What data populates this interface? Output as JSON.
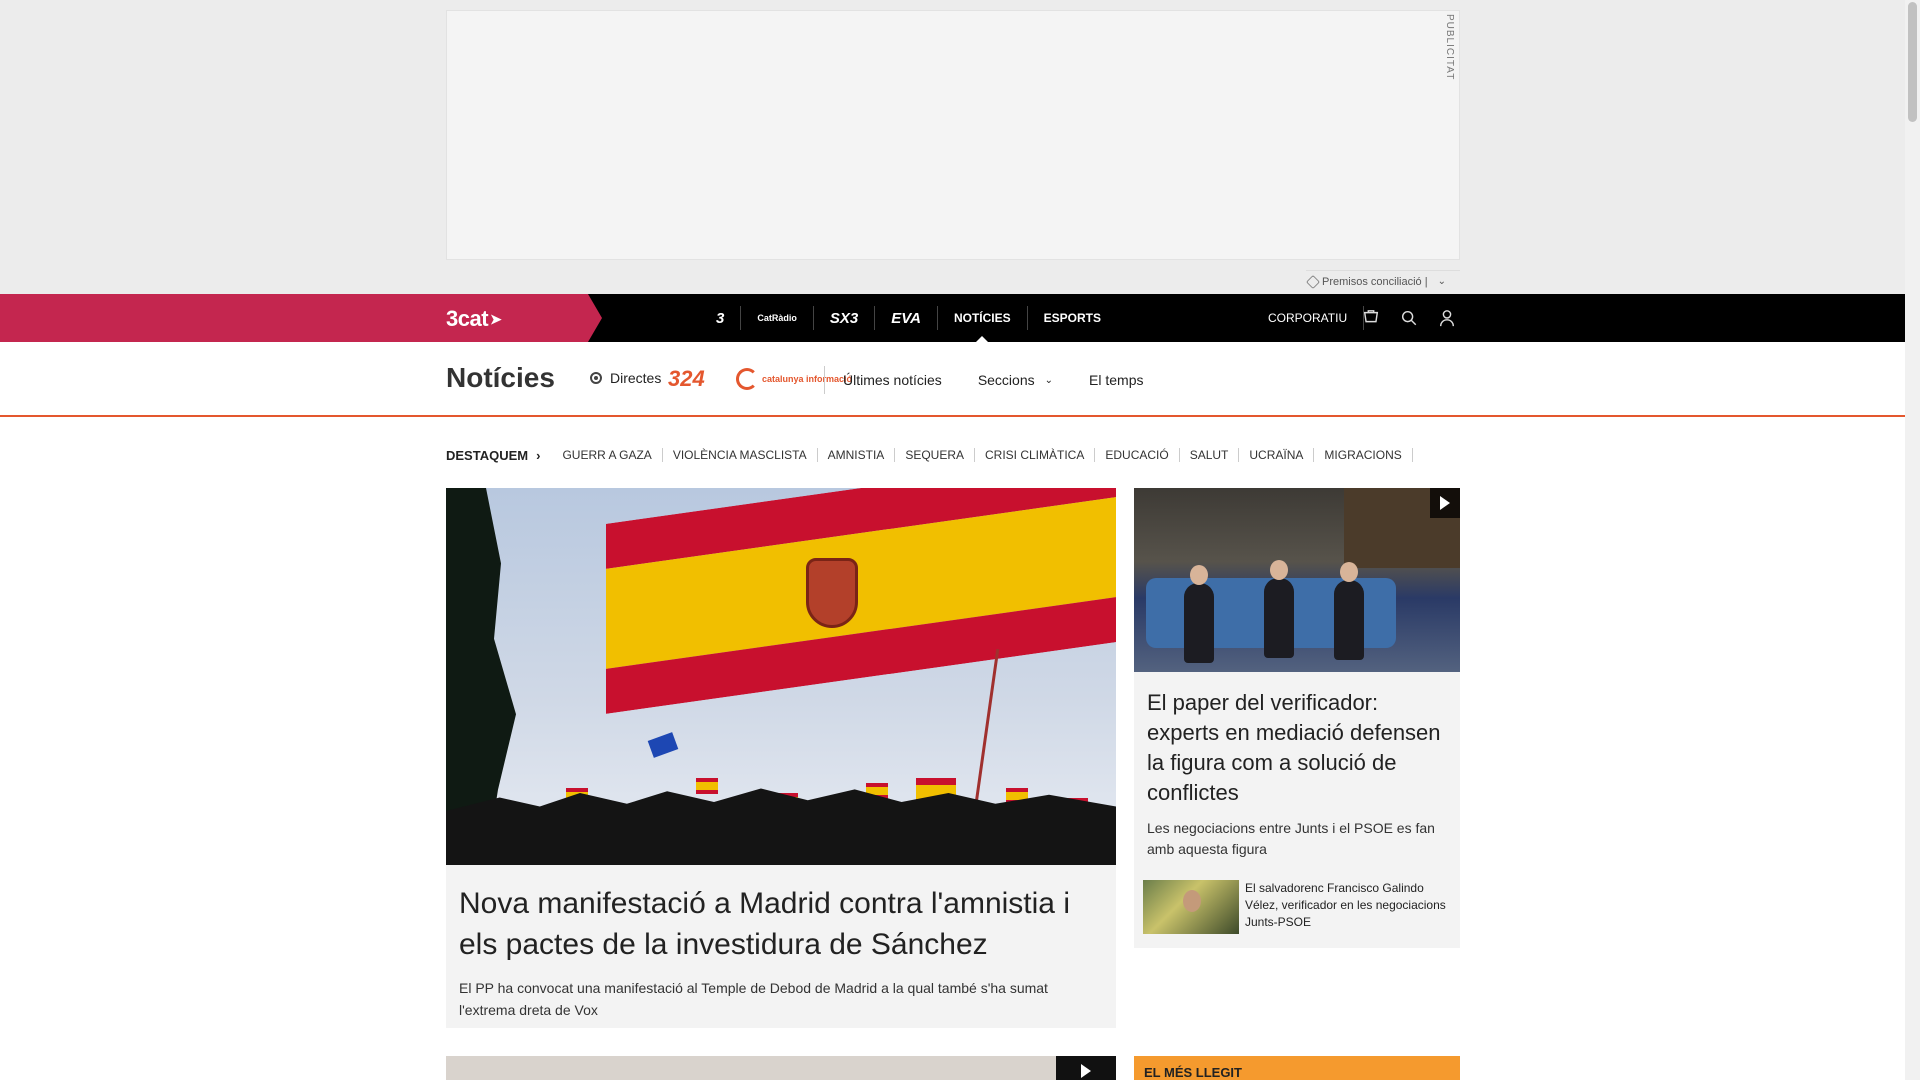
{
  "ad": {
    "label": "PUBLICITAT",
    "bar_text": "Premisos conciliació |"
  },
  "topnav": {
    "brand": "3cat",
    "channels": [
      {
        "name": "tv3",
        "label": "3"
      },
      {
        "name": "catradio",
        "label": "CatRàdio"
      },
      {
        "name": "sx3",
        "label": "SX3"
      },
      {
        "name": "eva",
        "label": "EVA"
      }
    ],
    "links": {
      "noticies": "NOTÍCIES",
      "esports": "ESPORTS",
      "corporatiu": "CORPORATIU"
    },
    "icons": [
      "cart-icon",
      "search-icon",
      "user-icon"
    ]
  },
  "section": {
    "title": "Notícies",
    "directes": "Directes",
    "logo_324": "324",
    "logo_ci": "catalunya informació",
    "links": {
      "ultimes": "Últimes notícies",
      "seccions": "Seccions",
      "temps": "El temps"
    }
  },
  "destaquem": {
    "label": "DESTAQUEM",
    "items": [
      "GUERR A GAZA",
      "VIOLÈNCIA MASCLISTA",
      "AMNISTIA",
      "SEQUERA",
      "CRISI CLIMÀTICA",
      "EDUCACIÓ",
      "SALUT",
      "UCRAÏNA",
      "MIGRACIONS"
    ]
  },
  "main_story": {
    "headline": "Nova manifestació a Madrid contra l'amnistia i els pactes de la investidura de Sánchez",
    "summary": "El PP ha convocat una manifestació al Temple de Debod de Madrid a la qual també s'ha sumat l'extrema dreta de Vox"
  },
  "side_story": {
    "headline": "El paper del verificador: experts en mediació defensen la figura com a solució de conflictes",
    "summary": "Les negociacions entre Junts i el PSOE es fan amb aquesta figura",
    "related": "El salvadorenc Francisco Galindo Vélez, verificador en les negociacions Junts-PSOE"
  },
  "mes_llegit": {
    "label": "EL MÉS LLEGIT"
  },
  "colors": {
    "brand": "#c4264f",
    "accent": "#e4572e",
    "mes_llegit": "#f59a2e"
  }
}
